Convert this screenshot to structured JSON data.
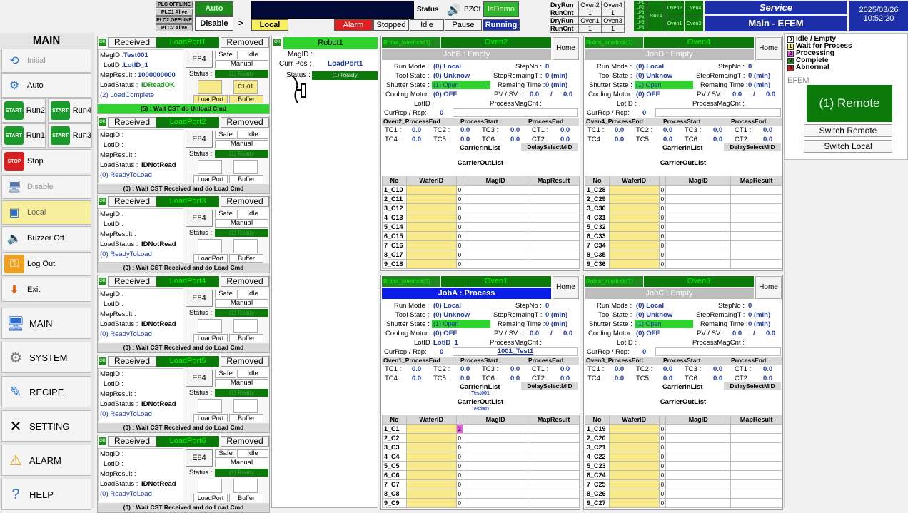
{
  "topbar": {
    "plc_labels": [
      "PLC OFFLINE",
      "PLC1 Alive",
      "PLC2 OFFLINE",
      "PLC2 Alive"
    ],
    "auto": "Auto",
    "disable": "Disable",
    "arrow": ">",
    "local": "Local",
    "status_label": "Status",
    "bzof": "BZOf",
    "isdemo": "IsDemo",
    "alarm": "Alarm",
    "stopped": "Stopped",
    "idle": "Idle",
    "pause": "Pause",
    "running": "Running",
    "run_table": [
      [
        "DryRun",
        "Oven2",
        "Oven4"
      ],
      [
        "RunCnt",
        "1",
        "1"
      ],
      [
        "DryRun",
        "Oven1",
        "Oven3"
      ],
      [
        "RunCnt",
        "1",
        "1"
      ]
    ],
    "lp_list": [
      "LP1",
      "LP2",
      "LP3",
      "LP4",
      "LP5",
      "LP6"
    ],
    "rbt": "RBT1",
    "oven_mini": [
      "Oven2",
      "Oven4",
      "Oven1",
      "Oven3"
    ],
    "service": "Service",
    "main_efem": "Main - EFEM",
    "date": "2025/03/26",
    "time": "10:52:20"
  },
  "sidebar": {
    "title": "MAIN",
    "initial": "Initial",
    "auto": "Auto",
    "run2": "Run2",
    "run4": "Run4",
    "run1": "Run1",
    "run3": "Run3",
    "start": "START",
    "stop": "Stop",
    "stop_icon": "STOP",
    "disable": "Disable",
    "local": "Local",
    "buzzer": "Buzzer Off",
    "logout": "Log Out",
    "exit": "Exit",
    "nav": [
      "MAIN",
      "SYSTEM",
      "RECIPE",
      "SETTING",
      "ALARM",
      "HELP"
    ]
  },
  "loadports": [
    {
      "name": "LoadPort1",
      "magid": "Test001",
      "lotid": "LotID_1",
      "mapresult": "1000000000",
      "loadstatus": "IDReadOK",
      "state": "(2) LoadComplete",
      "footer": "(5) : Wait CST do Unload Cmd",
      "carrier": "C1-01"
    },
    {
      "name": "LoadPort2",
      "magid": "",
      "lotid": "",
      "mapresult": "",
      "loadstatus": "IDNotRead",
      "state": "(0) ReadyToLoad",
      "footer": "(0) : Wait CST Received and do Load Cmd",
      "carrier": ""
    },
    {
      "name": "LoadPort3",
      "magid": "",
      "lotid": "",
      "mapresult": "",
      "loadstatus": "IDNotRead",
      "state": "(0) ReadyToLoad",
      "footer": "(0) : Wait CST Received and do Load Cmd",
      "carrier": ""
    },
    {
      "name": "LoadPort4",
      "magid": "",
      "lotid": "",
      "mapresult": "",
      "loadstatus": "IDNotRead",
      "state": "(0) ReadyToLoad",
      "footer": "(0) : Wait CST Received and do Load Cmd",
      "carrier": ""
    },
    {
      "name": "LoadPort5",
      "magid": "",
      "lotid": "",
      "mapresult": "",
      "loadstatus": "IDNotRead",
      "state": "(0) ReadyToLoad",
      "footer": "(0) : Wait CST Received and do Load Cmd",
      "carrier": ""
    },
    {
      "name": "LoadPort6",
      "magid": "",
      "lotid": "",
      "mapresult": "",
      "loadstatus": "IDNotRead",
      "state": "(0) ReadyToLoad",
      "footer": "(0) : Wait CST Received and do Load Cmd",
      "carrier": ""
    }
  ],
  "lp_labels": {
    "ok": "OK",
    "received": "Received",
    "removed": "Removed",
    "e84": "E84",
    "safe": "Safe",
    "idle": "Idle",
    "manual": "Manual",
    "status": "Status :",
    "ready": "(1) Ready",
    "loadport": "LoadPort",
    "buffer": "Buffer",
    "magid": "MagID :",
    "lotid": "LotID :",
    "mapresult": "MapResult :",
    "loadstatus": "LoadStatus :"
  },
  "robot": {
    "title": "Robot1",
    "ok": "OK",
    "magid_label": "MagID :",
    "curpos_label": "Curr Pos :",
    "curpos": "LoadPort1",
    "status_label": "Status :",
    "status": "(1) Ready"
  },
  "ovens": [
    {
      "name": "Oven2",
      "job": "JobB : Empty",
      "active": false,
      "lotid": "",
      "rcp": "",
      "pe_label": "Oven2_ProcessEnd",
      "in_list": "",
      "out_list": "",
      "wafers": [
        [
          "1_C10",
          "0"
        ],
        [
          "2_C11",
          "0"
        ],
        [
          "3_C12",
          "0"
        ],
        [
          "4_C13",
          "0"
        ],
        [
          "5_C14",
          "0"
        ],
        [
          "6_C15",
          "0"
        ],
        [
          "7_C16",
          "0"
        ],
        [
          "8_C17",
          "0"
        ],
        [
          "9_C18",
          "0"
        ]
      ]
    },
    {
      "name": "Oven4",
      "job": "JobD : Empty",
      "active": false,
      "lotid": "",
      "rcp": "",
      "pe_label": "Oven4_ProcessEnd",
      "in_list": "",
      "out_list": "",
      "wafers": [
        [
          "1_C28",
          "0"
        ],
        [
          "2_C29",
          "0"
        ],
        [
          "3_C30",
          "0"
        ],
        [
          "4_C31",
          "0"
        ],
        [
          "5_C32",
          "0"
        ],
        [
          "6_C33",
          "0"
        ],
        [
          "7_C34",
          "0"
        ],
        [
          "8_C35",
          "0"
        ],
        [
          "9_C36",
          "0"
        ]
      ]
    },
    {
      "name": "Oven1",
      "job": "JobA : Process",
      "active": true,
      "lotid": "LotID_1",
      "rcp": "1001_Test1",
      "pe_label": "Oven1_ProcessEnd",
      "in_list": "Test001",
      "out_list": "Test001",
      "wafers": [
        [
          "1_C1",
          "2"
        ],
        [
          "2_C2",
          "0"
        ],
        [
          "3_C3",
          "0"
        ],
        [
          "4_C4",
          "0"
        ],
        [
          "5_C5",
          "0"
        ],
        [
          "6_C6",
          "0"
        ],
        [
          "7_C7",
          "0"
        ],
        [
          "8_C8",
          "0"
        ],
        [
          "9_C9",
          "0"
        ]
      ]
    },
    {
      "name": "Oven3",
      "job": "JobC : Empty",
      "active": false,
      "lotid": "",
      "rcp": "",
      "pe_label": "Oven3_ProcessEnd",
      "in_list": "",
      "out_list": "",
      "wafers": [
        [
          "1_C19",
          "0"
        ],
        [
          "2_C20",
          "0"
        ],
        [
          "3_C21",
          "0"
        ],
        [
          "4_C22",
          "0"
        ],
        [
          "5_C23",
          "0"
        ],
        [
          "6_C24",
          "0"
        ],
        [
          "7_C25",
          "0"
        ],
        [
          "8_C26",
          "0"
        ],
        [
          "9_C27",
          "0"
        ]
      ]
    }
  ],
  "oven_labels": {
    "interlock": "Robot_Interlock(1)",
    "home": "Home",
    "runmode_l": "Run Mode :",
    "runmode": "(0) Local",
    "stepno_l": "StepNo :",
    "stepno": "0",
    "toolstate_l": "Tool State :",
    "toolstate": "(0) Unknow",
    "stepremain_l": "StepRemaingT :",
    "stepremain": "0 (min)",
    "shutter_l": "Shutter State :",
    "shutter": "(1) Open",
    "remain_l": "Remaing Time :",
    "remain": "0 (min)",
    "cooling_l": "Cooling Motor :",
    "cooling": "(0) OFF",
    "pvsv_l": "PV / SV :",
    "pv": "0.0",
    "slash": "/",
    "sv": "0.0",
    "lotid_l": "LotID :",
    "magcnt_l": "ProcessMagCnt :",
    "rcp_l": "CurRcp / Rcp:",
    "rcp_v": "0",
    "ps": "ProcessStart",
    "pe": "ProcessEnd",
    "tc": [
      [
        "TC1 :",
        "0.0"
      ],
      [
        "TC2 :",
        "0.0"
      ],
      [
        "TC3 :",
        "0.0"
      ],
      [
        "CT1 :",
        "0.0"
      ],
      [
        "TC4 :",
        "0.0"
      ],
      [
        "TC5 :",
        "0.0"
      ],
      [
        "TC6 :",
        "0.0"
      ],
      [
        "CT2 :",
        "0.0"
      ]
    ],
    "carrierin": "CarrierInList",
    "delay": "DelaySelectMID",
    "carrierout": "CarrierOutList",
    "cols": [
      "No",
      "WaferID",
      "MagID",
      "MapResult"
    ]
  },
  "legend": {
    "items": [
      [
        "0",
        "Idle / Empty",
        "#ffffff"
      ],
      [
        "1",
        "Wait for Process",
        "#f7ee7a"
      ],
      [
        "2",
        "Processing",
        "#e85ee0"
      ],
      [
        "3",
        "Complete",
        "#1e8a1e"
      ],
      [
        "4",
        "Abnormal",
        "#c81e1e"
      ]
    ],
    "efem": "EFEM",
    "remote": "(1) Remote",
    "switch_remote": "Switch Remote",
    "switch_local": "Switch Local"
  }
}
